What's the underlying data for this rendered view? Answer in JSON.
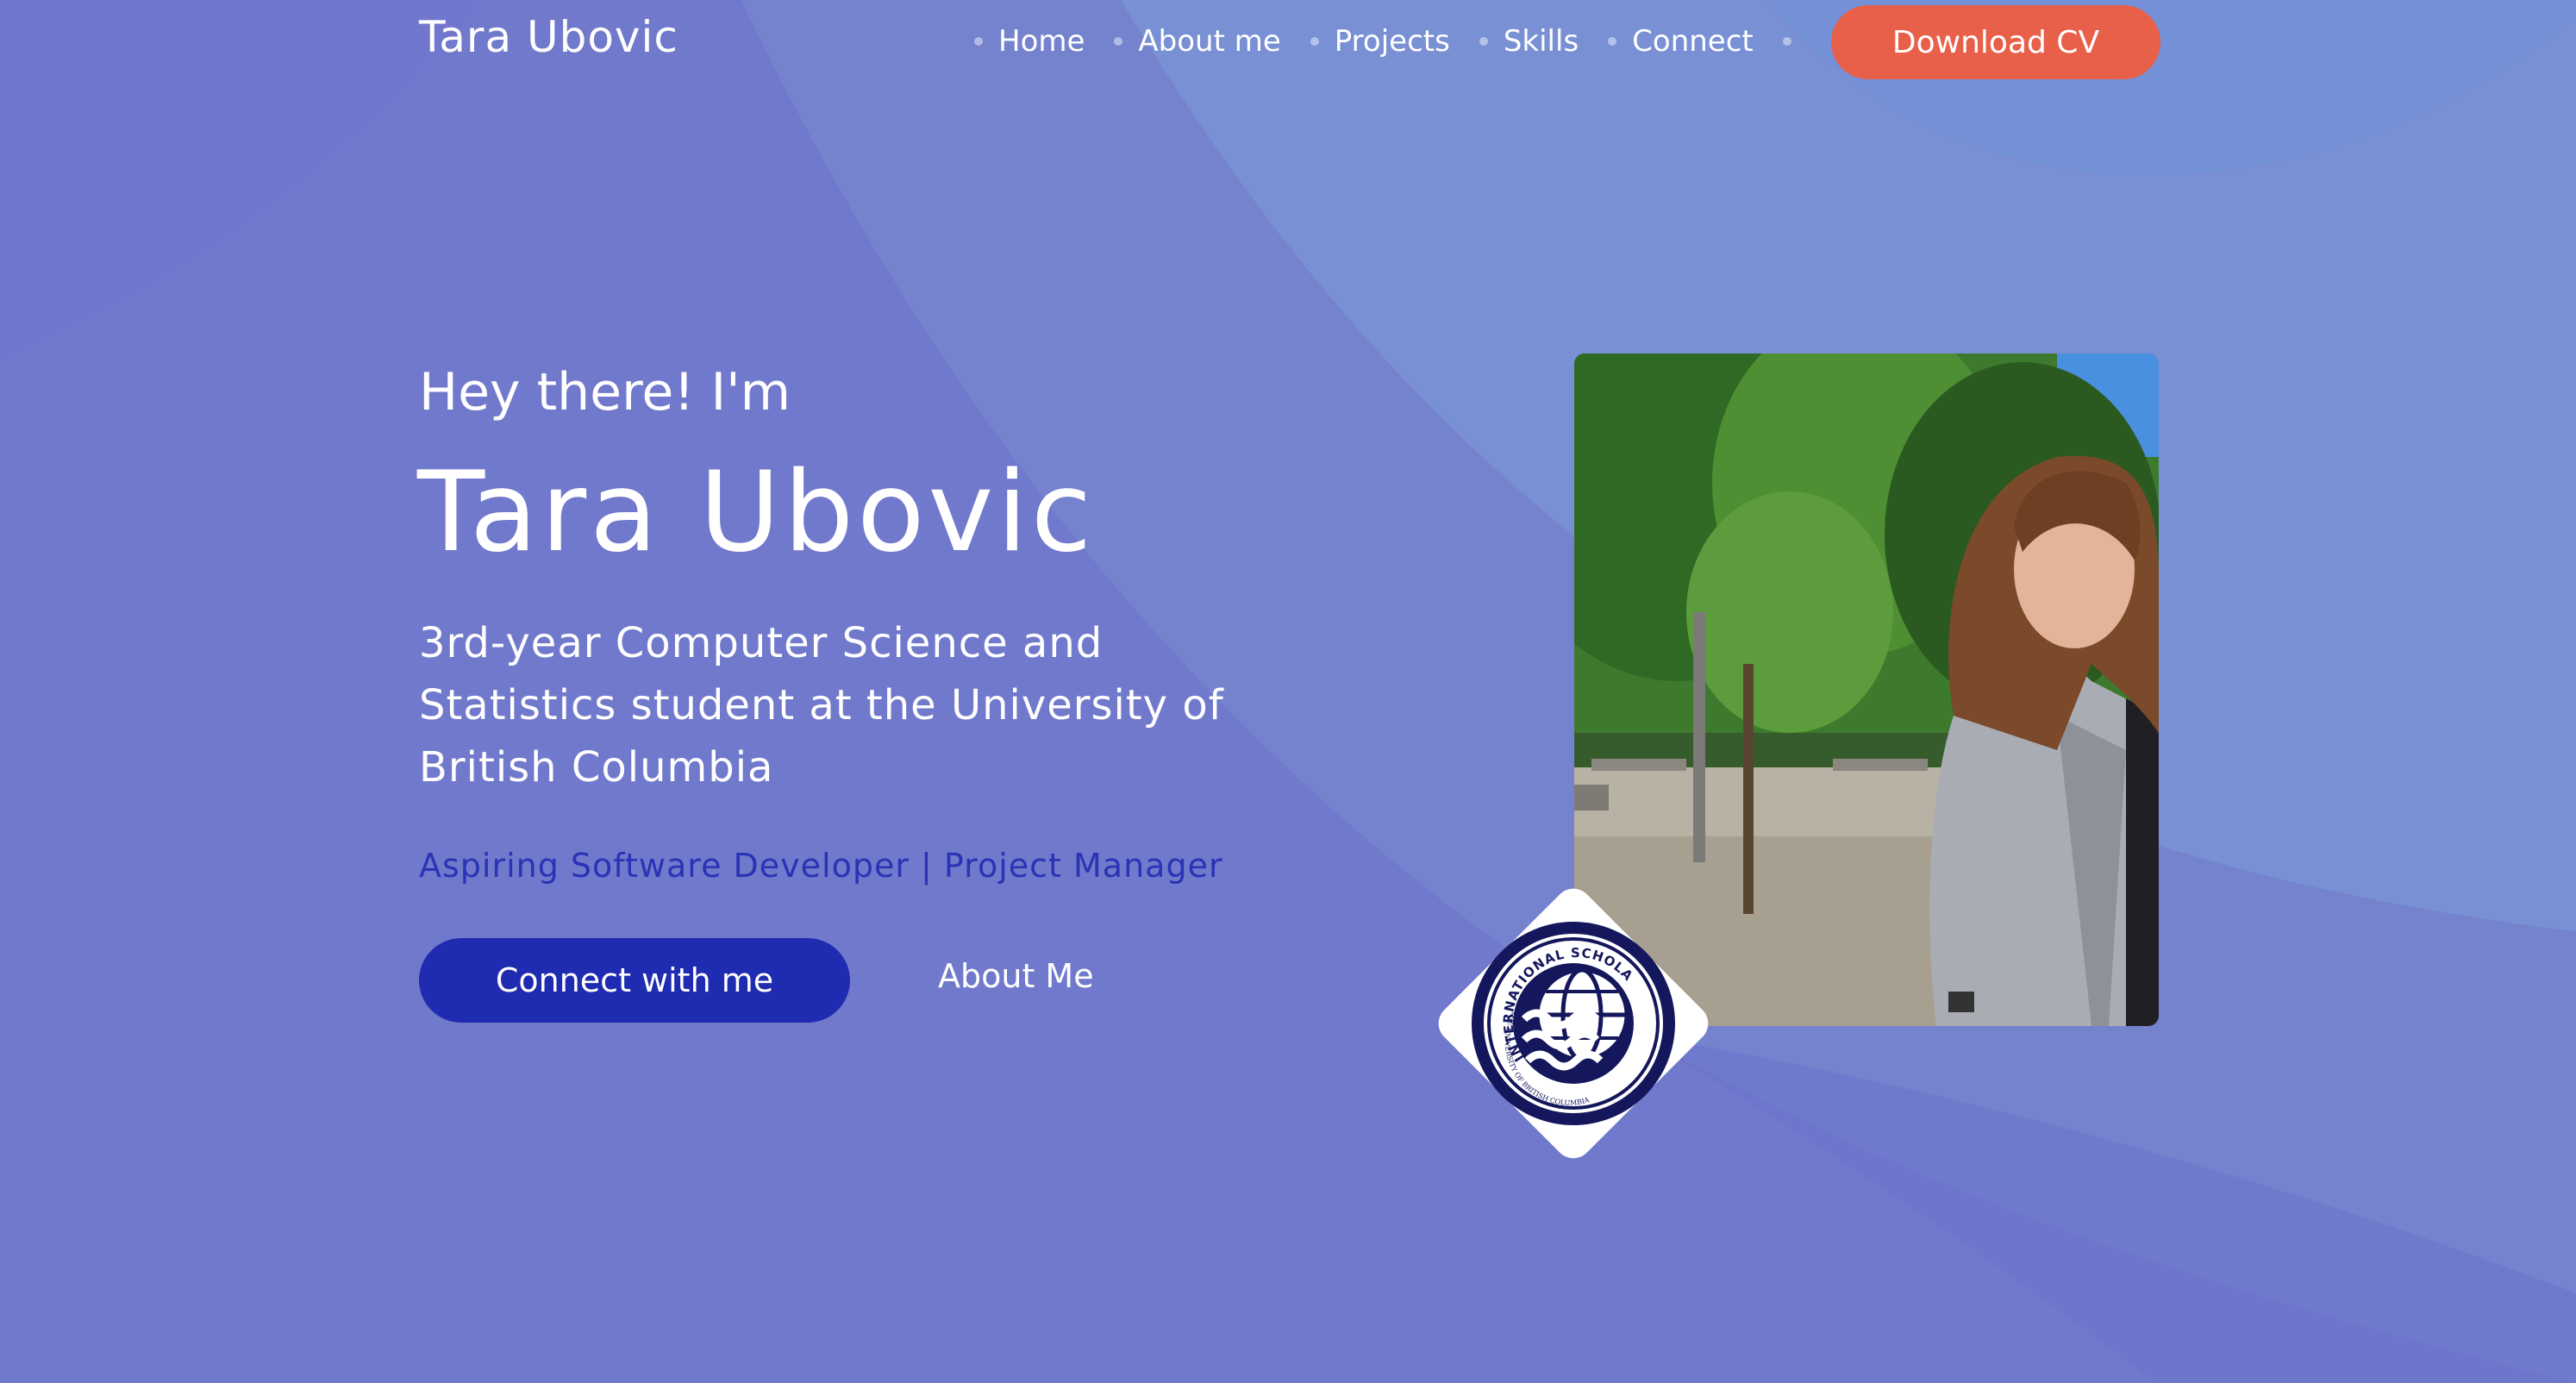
{
  "header": {
    "brand": "Tara Ubovic",
    "nav": [
      {
        "label": "Home"
      },
      {
        "label": "About me"
      },
      {
        "label": "Projects"
      },
      {
        "label": "Skills"
      },
      {
        "label": "Connect"
      }
    ],
    "cv_label": "Download CV"
  },
  "hero": {
    "greeting": "Hey there! I'm",
    "name": "Tara Ubovic",
    "description": "3rd-year Computer Science and Statistics student at the University of British Columbia",
    "tagline": "Aspiring Software Developer | Project Manager",
    "connect_label": "Connect with me",
    "about_label": "About Me"
  },
  "seal": {
    "top_text": "INTERNATIONAL SCHOLARS",
    "bottom_text": "THE UNIVERSITY OF BRITISH COLUMBIA"
  },
  "colors": {
    "background": "#7179cc",
    "accent_cv": "#e8604a",
    "accent_primary": "#1f2bb0",
    "tagline": "#2a33b5"
  }
}
